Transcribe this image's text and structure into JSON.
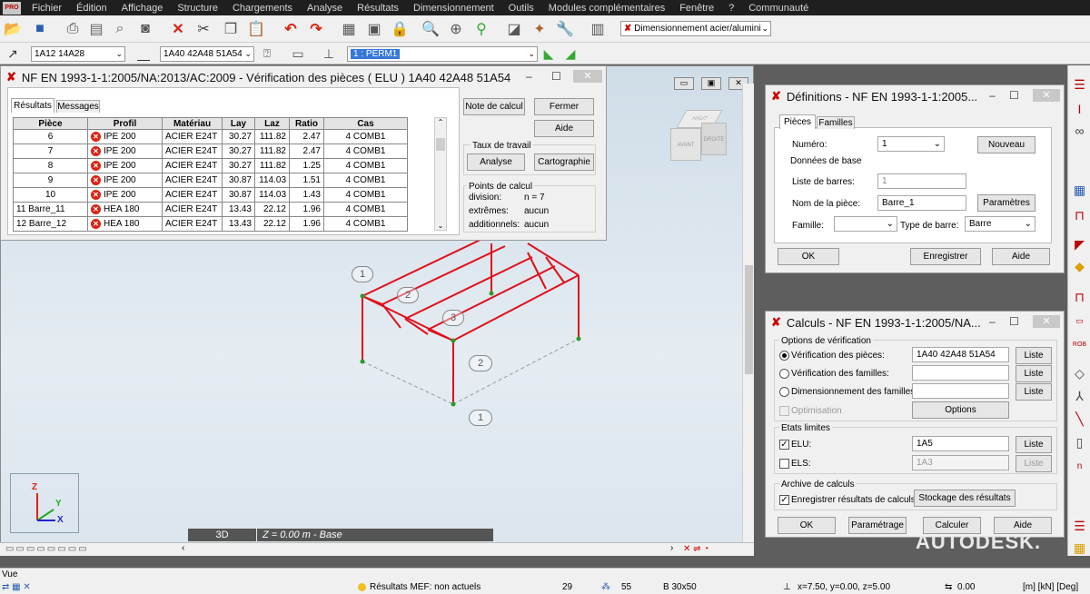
{
  "menu": [
    "Fichier",
    "Édition",
    "Affichage",
    "Structure",
    "Chargements",
    "Analyse",
    "Résultats",
    "Dimensionnement",
    "Outils",
    "Modules complémentaires",
    "Fenêtre",
    "?",
    "Communauté"
  ],
  "menu_logo": "PRO",
  "toolbar": {
    "design_dropdown": "Dimensionnement acier/alumini",
    "bar_selection": "1A12 14A28",
    "piece_selection": "1A40 42A48 51A54",
    "case_selection": "1 : PERM1"
  },
  "verif_dialog": {
    "title": "NF EN 1993-1-1:2005/NA:2013/AC:2009 - Vérification des pièces ( ELU ) 1A40 42A48 51A54",
    "tabs": [
      "Résultats",
      "Messages"
    ],
    "columns": [
      "Pièce",
      "Profil",
      "Matériau",
      "Lay",
      "Laz",
      "Ratio",
      "Cas"
    ],
    "rows": [
      [
        "6",
        "IPE 200",
        "ACIER E24T",
        "30.27",
        "111.82",
        "2.47",
        "4 COMB1"
      ],
      [
        "7",
        "IPE 200",
        "ACIER E24T",
        "30.27",
        "111.82",
        "2.47",
        "4 COMB1"
      ],
      [
        "8",
        "IPE 200",
        "ACIER E24T",
        "30.27",
        "111.82",
        "1.25",
        "4 COMB1"
      ],
      [
        "9",
        "IPE 200",
        "ACIER E24T",
        "30.87",
        "114.03",
        "1.51",
        "4 COMB1"
      ],
      [
        "10",
        "IPE 200",
        "ACIER E24T",
        "30.87",
        "114.03",
        "1.43",
        "4 COMB1"
      ],
      [
        "11 Barre_11",
        "HEA 180",
        "ACIER E24T",
        "13.43",
        "22.12",
        "1.96",
        "4 COMB1"
      ],
      [
        "12 Barre_12",
        "HEA 180",
        "ACIER E24T",
        "13.43",
        "22.12",
        "1.96",
        "4 COMB1"
      ]
    ],
    "note_button": "Note de calcul",
    "close_button": "Fermer",
    "help_button": "Aide",
    "taux_group": "Taux de travail",
    "analyse_button": "Analyse",
    "carto_button": "Cartographie",
    "points_group": "Points de calcul",
    "division_label": "division:",
    "division_value": "n = 7",
    "extremes_label": "extrêmes:",
    "extremes_value": "aucun",
    "add_label": "additionnels:",
    "add_value": "aucun"
  },
  "def_dialog": {
    "title": "Définitions - NF EN 1993-1-1:2005...",
    "tabs": [
      "Pièces",
      "Familles"
    ],
    "numero_label": "Numéro:",
    "numero_value": "1",
    "nouveau_button": "Nouveau",
    "base_group": "Données de base",
    "liste_label": "Liste de barres:",
    "liste_value": "1",
    "nom_label": "Nom de la pièce:",
    "nom_value": "Barre_1",
    "params_button": "Paramètres",
    "famille_label": "Famille:",
    "type_label": "Type de barre:",
    "type_value": "Barre",
    "ok_button": "OK",
    "save_button": "Enregistrer",
    "help_button": "Aide"
  },
  "calc_dialog": {
    "title": "Calculs - NF EN 1993-1-1:2005/NA...",
    "options_group": "Options de vérification",
    "opt1": "Vérification des pièces:",
    "opt1_value": "1A40 42A48 51A54",
    "opt2": "Vérification des familles:",
    "opt3": "Dimensionnement des familles:",
    "liste_button": "Liste",
    "optim_label": "Optimisation",
    "options_button": "Options",
    "etats_group": "Etats limites",
    "elu_label": "ELU:",
    "elu_value": "1A5",
    "els_label": "ELS:",
    "els_value": "1A3",
    "archive_group": "Archive de calculs",
    "save_label": "Enregistrer résultats de calculs",
    "stockage_button": "Stockage des résultats",
    "ok_button": "OK",
    "param_button": "Paramétrage",
    "calc_button": "Calculer",
    "help_button": "Aide"
  },
  "viewport": {
    "tab_3d": "3D",
    "z_label": "Z = 0.00 m - Base",
    "cube_top": "HAUT",
    "cube_front": "AVANT",
    "cube_right": "DROITE",
    "axis_z": "Z",
    "axis_y": "Y",
    "axis_x": "X",
    "labels": [
      "1",
      "2",
      "3",
      "2",
      "1"
    ]
  },
  "autodesk": "AUTODESK.",
  "status": {
    "vue": "Vue",
    "mef": "Résultats MEF: non actuels",
    "n1": "29",
    "n2": "55",
    "section": "B 30x50",
    "coords": "x=7.50, y=0.00, z=5.00",
    "angle": "0.00",
    "units": "[m] [kN] [Deg]"
  },
  "colors": {
    "structure": "#e0101a",
    "accent": "#3478d8"
  }
}
